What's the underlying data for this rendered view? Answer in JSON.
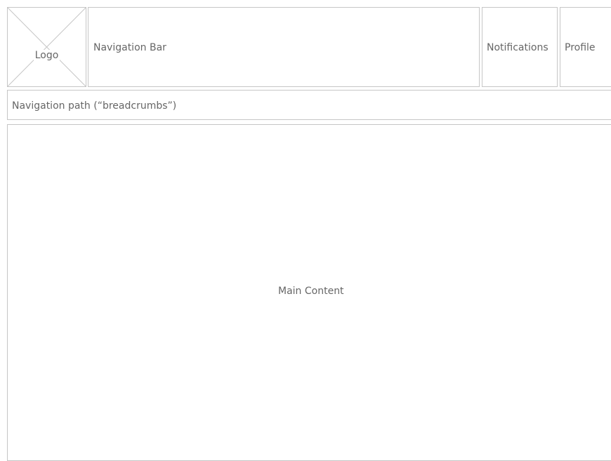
{
  "header": {
    "logo": {
      "label": "Logo"
    },
    "navigation_bar": {
      "label": "Navigation Bar"
    },
    "notifications": {
      "label": "Notifications"
    },
    "profile": {
      "label": "Profile"
    }
  },
  "breadcrumbs": {
    "label": "Navigation path (“breadcrumbs”)"
  },
  "main": {
    "label": "Main Content"
  },
  "colors": {
    "border": "#c6c6c6",
    "text": "#666666",
    "background": "#ffffff"
  }
}
